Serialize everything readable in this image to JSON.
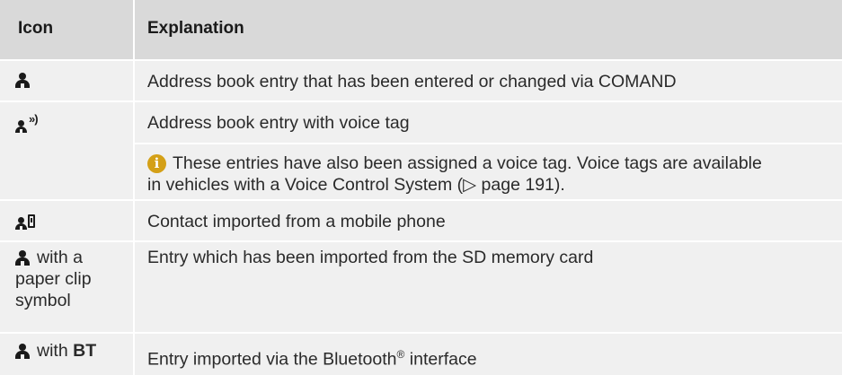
{
  "table": {
    "header": {
      "icon": "Icon",
      "explanation": "Explanation"
    },
    "rows": [
      {
        "icon_name": "address-book-person-icon",
        "icon_text": "",
        "explanation": "Address book entry that has been entered or changed via COMAND"
      },
      {
        "icon_name": "voice-tag-person-icon",
        "icon_text": "",
        "explanation": "Address book entry with voice tag",
        "note_line1": "These entries have also been assigned a voice tag. Voice tags are available",
        "note_line2": "in vehicles with a Voice Control System (▷ page 191)."
      },
      {
        "icon_name": "mobile-phone-contact-icon",
        "icon_text": "",
        "explanation": "Contact imported from a mobile phone"
      },
      {
        "icon_name": "person-icon",
        "icon_line1": "with a",
        "icon_line2": "paper clip",
        "icon_line3": "symbol",
        "explanation": "Entry which has been imported from the SD memory card"
      },
      {
        "icon_name": "person-icon",
        "icon_with": "with",
        "icon_bt": "BT",
        "explanation_pre": "Entry imported via the Bluetooth",
        "explanation_reg": "®",
        "explanation_post": " interface"
      }
    ]
  },
  "colors": {
    "header_bg": "#d9d9d9",
    "row_bg": "#f0f0f0",
    "info": "#d4a017"
  }
}
